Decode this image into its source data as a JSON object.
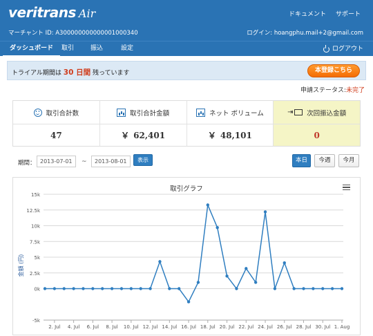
{
  "header": {
    "logo_main": "veritrans",
    "logo_sub": "Air",
    "links": [
      "ドキュメント",
      "サポート"
    ],
    "merchant": "マーチャント ID: A300000000000001000340",
    "login": "ログイン: hoangphu.mail+2@gmail.com"
  },
  "nav": {
    "items": [
      "ダッシュボード",
      "取引",
      "振込",
      "設定"
    ],
    "active": 0,
    "logout": "ログアウト"
  },
  "trial": {
    "prefix": "トライアル期間は",
    "days": "30 日間",
    "suffix": "残っています",
    "register_label": "本登録こちら"
  },
  "status": {
    "label": "申請ステータス:",
    "value": "未完了"
  },
  "stats": [
    {
      "label": "取引合計数",
      "icon": "smile-icon",
      "value": "47",
      "currency": ""
    },
    {
      "label": "取引合計金額",
      "icon": "bar-chart-icon",
      "value": "62,401",
      "currency": "￥"
    },
    {
      "label": "ネット ボリューム",
      "icon": "bar-chart-icon",
      "value": "48,101",
      "currency": "￥"
    },
    {
      "label": "次回振込金額",
      "icon": "money-transfer-icon",
      "value": "0",
      "currency": ""
    }
  ],
  "filter": {
    "label": "期間：",
    "from": "2013-07-01",
    "tilde": "~",
    "to": "2013-08-01",
    "show_label": "表示",
    "ranges": [
      "本日",
      "今週",
      "今月"
    ],
    "active_range": 0
  },
  "chart_data": {
    "type": "line",
    "title": "取引グラフ",
    "ylabel": "金額 (円)",
    "xlabel": "",
    "ylim": [
      -5000,
      15000
    ],
    "yticks": [
      "-5k",
      "0k",
      "2.5k",
      "5k",
      "7.5k",
      "10k",
      "12.5k",
      "15k"
    ],
    "ytick_values": [
      -5000,
      0,
      2500,
      5000,
      7500,
      10000,
      12500,
      15000
    ],
    "xtick_labels": [
      "2. Jul",
      "4. Jul",
      "6. Jul",
      "8. Jul",
      "10. Jul",
      "12. Jul",
      "14. Jul",
      "16. Jul",
      "18. Jul",
      "20. Jul",
      "22. Jul",
      "24. Jul",
      "26. Jul",
      "28. Jul",
      "30. Jul",
      "1. Aug"
    ],
    "x": [
      "1. Jul",
      "2. Jul",
      "3. Jul",
      "4. Jul",
      "5. Jul",
      "6. Jul",
      "7. Jul",
      "8. Jul",
      "9. Jul",
      "10. Jul",
      "11. Jul",
      "12. Jul",
      "13. Jul",
      "14. Jul",
      "15. Jul",
      "16. Jul",
      "17. Jul",
      "18. Jul",
      "19. Jul",
      "20. Jul",
      "21. Jul",
      "22. Jul",
      "23. Jul",
      "24. Jul",
      "25. Jul",
      "26. Jul",
      "27. Jul",
      "28. Jul",
      "29. Jul",
      "30. Jul",
      "31. Jul",
      "1. Aug"
    ],
    "series": [
      {
        "name": "",
        "color": "#2f7ec0",
        "values": [
          0,
          0,
          0,
          0,
          0,
          0,
          0,
          0,
          0,
          0,
          0,
          0,
          4300,
          0,
          0,
          -2100,
          1000,
          13300,
          9700,
          2000,
          0,
          3200,
          1000,
          12200,
          0,
          4100,
          0,
          0,
          0,
          0,
          0,
          0
        ]
      }
    ],
    "grid": true
  }
}
